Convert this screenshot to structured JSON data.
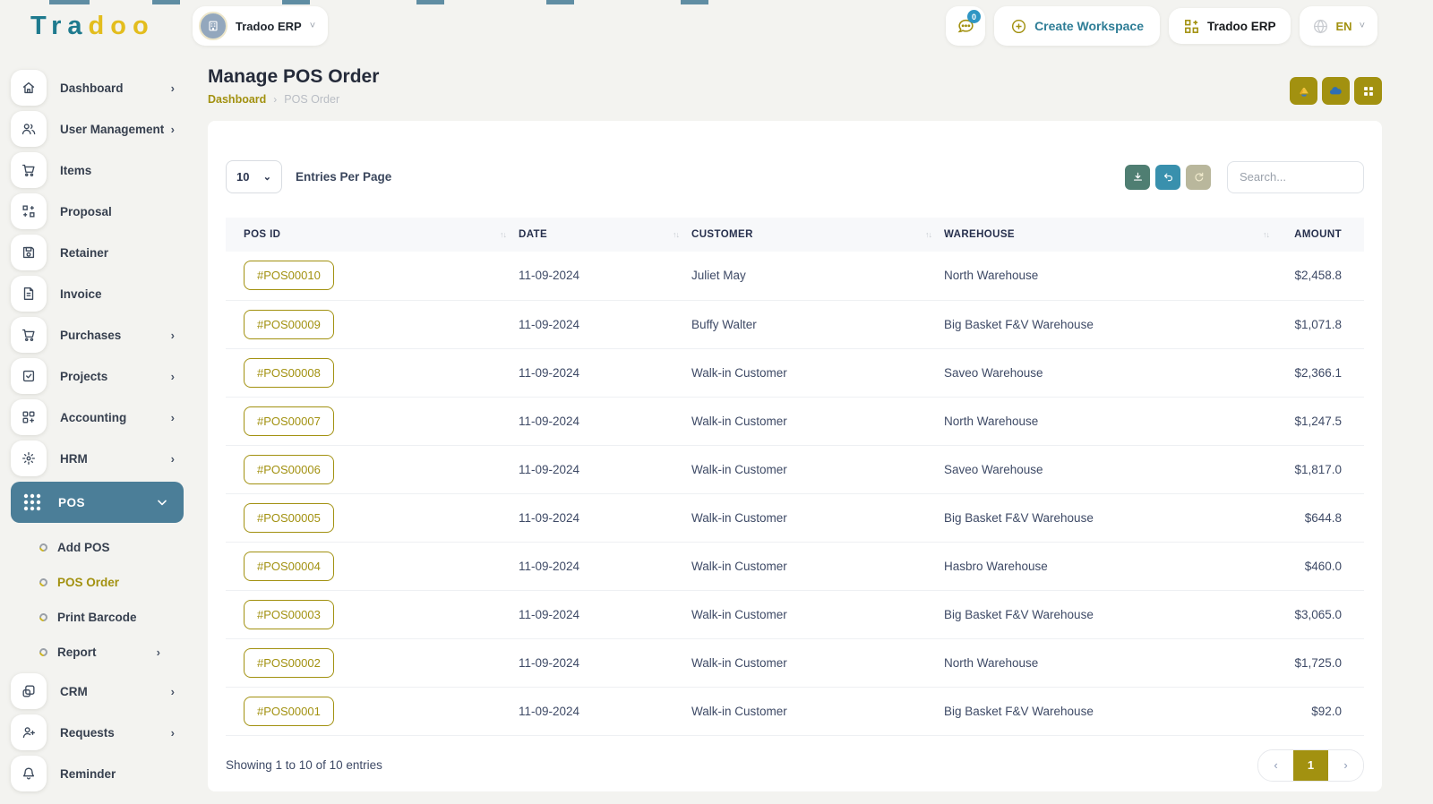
{
  "brand": {
    "name_teal": "Tra",
    "name_yellow": "doo"
  },
  "topbar": {
    "workspace": {
      "label": "Tradoo ERP",
      "avatar_icon": "building-icon"
    },
    "chat_badge": "0",
    "create_workspace_label": "Create Workspace",
    "erp_button_label": "Tradoo ERP",
    "language": "EN"
  },
  "sidebar": {
    "items": [
      {
        "label": "Dashboard",
        "icon": "home-icon",
        "expandable": true
      },
      {
        "label": "User Management",
        "icon": "users-icon",
        "expandable": true
      },
      {
        "label": "Items",
        "icon": "cart-icon",
        "expandable": false
      },
      {
        "label": "Proposal",
        "icon": "proposal-icon",
        "expandable": false
      },
      {
        "label": "Retainer",
        "icon": "retainer-icon",
        "expandable": false
      },
      {
        "label": "Invoice",
        "icon": "invoice-icon",
        "expandable": false
      },
      {
        "label": "Purchases",
        "icon": "cart-icon",
        "expandable": true
      },
      {
        "label": "Projects",
        "icon": "projects-icon",
        "expandable": true
      },
      {
        "label": "Accounting",
        "icon": "accounting-icon",
        "expandable": true
      },
      {
        "label": "HRM",
        "icon": "hrm-icon",
        "expandable": true
      },
      {
        "label": "POS",
        "icon": "dots-grid-icon",
        "expandable": true,
        "active": true,
        "expanded": true
      }
    ],
    "pos_submenu": [
      {
        "label": "Add POS",
        "active": false
      },
      {
        "label": "POS Order",
        "active": true
      },
      {
        "label": "Print Barcode",
        "active": false
      },
      {
        "label": "Report",
        "active": false,
        "expandable": true
      }
    ],
    "items_bottom": [
      {
        "label": "CRM",
        "icon": "crm-icon",
        "expandable": true
      },
      {
        "label": "Requests",
        "icon": "user-plus-icon",
        "expandable": true
      },
      {
        "label": "Reminder",
        "icon": "bell-icon",
        "expandable": false
      }
    ]
  },
  "page": {
    "title": "Manage POS Order",
    "breadcrumb": {
      "home": "Dashboard",
      "separator": "›",
      "current": "POS Order"
    },
    "header_actions": [
      "drive-icon",
      "cloud-icon",
      "apps-grid-icon"
    ]
  },
  "controls": {
    "entries_per_page_value": "10",
    "entries_per_page_label": "Entries Per Page",
    "buttons": [
      "download-icon",
      "undo-icon",
      "refresh-icon"
    ],
    "search_placeholder": "Search..."
  },
  "table": {
    "headers": [
      "POS ID",
      "DATE",
      "CUSTOMER",
      "WAREHOUSE",
      "AMOUNT"
    ],
    "rows": [
      {
        "pos_id": "#POS00010",
        "date": "11-09-2024",
        "customer": "Juliet May",
        "warehouse": "North Warehouse",
        "amount": "$2,458.8"
      },
      {
        "pos_id": "#POS00009",
        "date": "11-09-2024",
        "customer": "Buffy Walter",
        "warehouse": "Big Basket F&V Warehouse",
        "amount": "$1,071.8"
      },
      {
        "pos_id": "#POS00008",
        "date": "11-09-2024",
        "customer": "Walk-in Customer",
        "warehouse": "Saveo Warehouse",
        "amount": "$2,366.1"
      },
      {
        "pos_id": "#POS00007",
        "date": "11-09-2024",
        "customer": "Walk-in Customer",
        "warehouse": "North Warehouse",
        "amount": "$1,247.5"
      },
      {
        "pos_id": "#POS00006",
        "date": "11-09-2024",
        "customer": "Walk-in Customer",
        "warehouse": "Saveo Warehouse",
        "amount": "$1,817.0"
      },
      {
        "pos_id": "#POS00005",
        "date": "11-09-2024",
        "customer": "Walk-in Customer",
        "warehouse": "Big Basket F&V Warehouse",
        "amount": "$644.8"
      },
      {
        "pos_id": "#POS00004",
        "date": "11-09-2024",
        "customer": "Walk-in Customer",
        "warehouse": "Hasbro Warehouse",
        "amount": "$460.0"
      },
      {
        "pos_id": "#POS00003",
        "date": "11-09-2024",
        "customer": "Walk-in Customer",
        "warehouse": "Big Basket F&V Warehouse",
        "amount": "$3,065.0"
      },
      {
        "pos_id": "#POS00002",
        "date": "11-09-2024",
        "customer": "Walk-in Customer",
        "warehouse": "North Warehouse",
        "amount": "$1,725.0"
      },
      {
        "pos_id": "#POS00001",
        "date": "11-09-2024",
        "customer": "Walk-in Customer",
        "warehouse": "Big Basket F&V Warehouse",
        "amount": "$92.0"
      }
    ]
  },
  "footer": {
    "summary": "Showing 1 to 10 of 10 entries",
    "current_page": "1"
  },
  "colors": {
    "accent_olive": "#a29110",
    "brand_teal": "#1e7a8e",
    "brand_yellow": "#e3bd1d",
    "active_sidebar_bg": "#4b7e98",
    "badge_blue": "#2f96c4",
    "download_btn": "#4f7e72",
    "undo_btn": "#3990ad",
    "refresh_btn": "#b9b79c"
  }
}
